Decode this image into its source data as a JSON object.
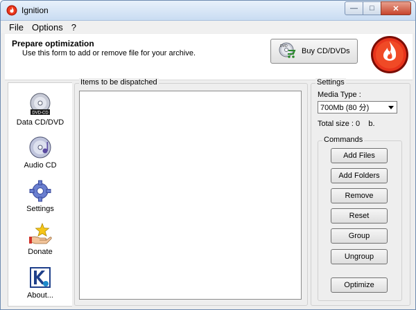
{
  "window": {
    "title": "Ignition"
  },
  "menu": {
    "file": "File",
    "options": "Options",
    "help": "?"
  },
  "header": {
    "title": "Prepare optimization",
    "subtitle": "Use this form to add or remove file for your archive.",
    "buy_label": "Buy CD/DVDs"
  },
  "sidebar": {
    "items": [
      {
        "label": "Data CD/DVD",
        "icon": "dvd-cd-icon",
        "badge": "DVD-CD"
      },
      {
        "label": "Audio CD",
        "icon": "audio-cd-icon"
      },
      {
        "label": "Settings",
        "icon": "gear-icon"
      },
      {
        "label": "Donate",
        "icon": "donate-icon"
      },
      {
        "label": "About...",
        "icon": "about-icon"
      }
    ]
  },
  "items_panel": {
    "title": "Items to be dispatched"
  },
  "settings": {
    "title": "Settings",
    "media_type_label": "Media Type :",
    "media_type_value": "700Mb (80 分)",
    "total_size": "Total size : 0    b."
  },
  "commands": {
    "title": "Commands",
    "add_files": "Add Files",
    "add_folders": "Add Folders",
    "remove": "Remove",
    "reset": "Reset",
    "group": "Group",
    "ungroup": "Ungroup",
    "optimize": "Optimize"
  },
  "colors": {
    "logo_red": "#e8341c",
    "title_bar": "#c9dcf2"
  }
}
